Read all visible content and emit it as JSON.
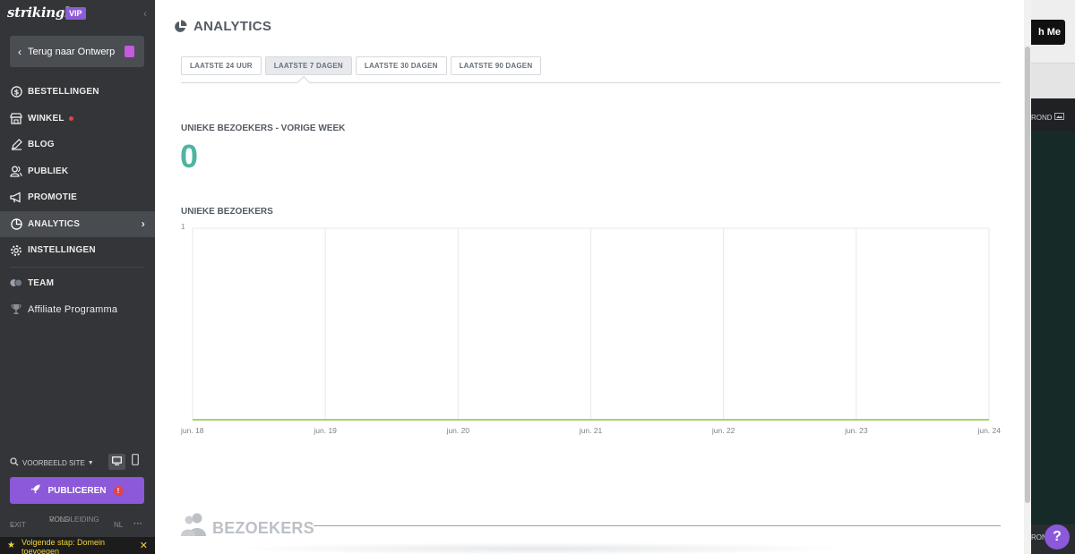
{
  "sidebar": {
    "logo": "strikingly",
    "vip": "VIP",
    "back_label": "Terug naar Ontwerp",
    "items": [
      {
        "label": "BESTELLINGEN"
      },
      {
        "label": "WINKEL"
      },
      {
        "label": "BLOG"
      },
      {
        "label": "PUBLIEK"
      },
      {
        "label": "PROMOTIE"
      },
      {
        "label": "ANALYTICS"
      },
      {
        "label": "INSTELLINGEN"
      }
    ],
    "team_label": "TEAM",
    "affiliate_label": "Affiliate Programma",
    "preview_label": "VOORBEELD SITE",
    "publish_label": "PUBLICEREN",
    "publish_warn": "!",
    "exit_label": "EXIT",
    "tour_label_1": "VOLG",
    "tour_label_2": "RONDLEIDING",
    "lang_label": "NL",
    "more_label": "···",
    "next_step_1": "Volgende stap: Domein",
    "next_step_2": "toevoegen"
  },
  "main": {
    "title": "ANALYTICS",
    "tabs": [
      {
        "label": "LAATSTE 24 UUR"
      },
      {
        "label": "LAATSTE 7 DAGEN"
      },
      {
        "label": "LAATSTE 30 DAGEN"
      },
      {
        "label": "LAATSTE 90 DAGEN"
      }
    ],
    "stat_label": "UNIEKE BEZOEKERS - VORIGE WEEK",
    "stat_value": "0",
    "chart_label": "UNIEKE BEZOEKERS",
    "section_title": "BEZOEKERS"
  },
  "right": {
    "match_label": "h Me",
    "rond_label": "ROND",
    "rond_label_2": "RON",
    "help_label": "?"
  },
  "colors": {
    "accent": "#8b59d9",
    "stat": "#4fb5a1",
    "line": "#8bc34a"
  },
  "chart_data": {
    "type": "line",
    "title": "UNIEKE BEZOEKERS",
    "categories": [
      "jun. 18",
      "jun. 19",
      "jun. 20",
      "jun. 21",
      "jun. 22",
      "jun. 23",
      "jun. 24"
    ],
    "series": [
      {
        "values": [
          0,
          0,
          0,
          0,
          0,
          0,
          0
        ]
      }
    ],
    "ylim": [
      0,
      1
    ],
    "y_ticks": [
      "1"
    ],
    "grid": true,
    "legend": "none"
  }
}
